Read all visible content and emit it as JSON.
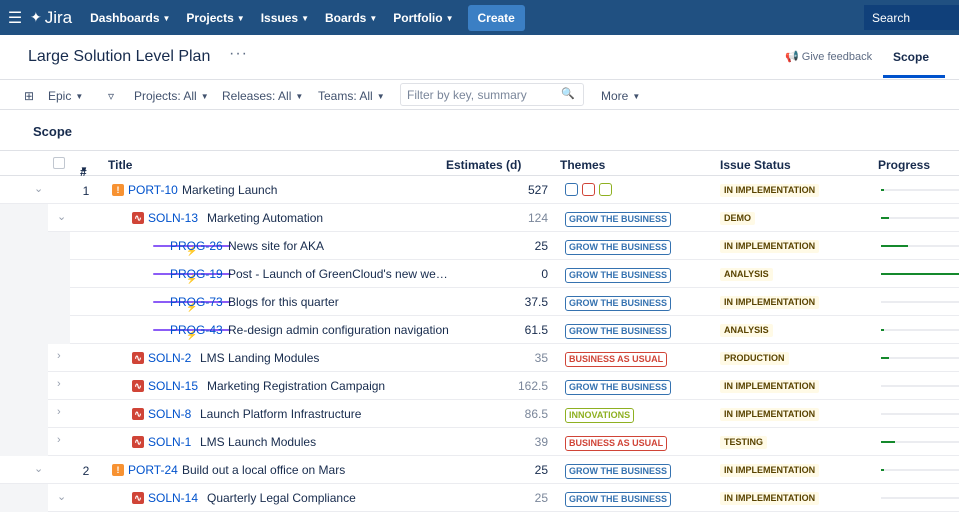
{
  "topbar": {
    "logo": "Jira",
    "nav": [
      "Dashboards",
      "Projects",
      "Issues",
      "Boards",
      "Portfolio"
    ],
    "create": "Create",
    "search": "Search"
  },
  "header": {
    "title": "Large Solution Level Plan",
    "more": "···",
    "feedback": "Give feedback",
    "scope_tab": "Scope"
  },
  "filters": {
    "hierarchy": "Epic",
    "projects": "Projects: All",
    "releases": "Releases: All",
    "teams": "Teams: All",
    "search_placeholder": "Filter by key, summary",
    "more": "More"
  },
  "section": "Scope",
  "columns": {
    "num": "#",
    "title": "Title",
    "estimates": "Estimates (d)",
    "themes": "Themes",
    "status": "Issue Status",
    "progress": "Progress"
  },
  "rows": [
    {
      "level": 0,
      "num": "1",
      "type": "port",
      "key": "PORT-10",
      "title": "Marketing Launch",
      "estimate": "527",
      "est_grey": false,
      "themes": "squares",
      "theme": "",
      "theme_style": "",
      "status": "IN IMPLEMENTATION",
      "progress": 0.03,
      "chev": "down"
    },
    {
      "level": 1,
      "num": "",
      "type": "soln",
      "key": "SOLN-13",
      "title": "Marketing Automation",
      "estimate": "124",
      "est_grey": true,
      "theme": "GROW THE BUSINESS",
      "theme_style": "grow",
      "status": "DEMO",
      "progress": 0.1,
      "chev": "down"
    },
    {
      "level": 2,
      "num": "",
      "type": "prog",
      "key": "PROG-26",
      "title": "News site for AKA",
      "estimate": "25",
      "est_grey": false,
      "theme": "GROW THE BUSINESS",
      "theme_style": "grow",
      "status": "IN IMPLEMENTATION",
      "progress": 0.35,
      "chev": ""
    },
    {
      "level": 2,
      "num": "",
      "type": "prog",
      "key": "PROG-19",
      "title": "Post - Launch of GreenCloud's new we…",
      "estimate": "0",
      "est_grey": false,
      "theme": "GROW THE BUSINESS",
      "theme_style": "grow",
      "status": "ANALYSIS",
      "progress": 1.0,
      "chev": ""
    },
    {
      "level": 2,
      "num": "",
      "type": "prog",
      "key": "PROG-73",
      "title": "Blogs for this quarter",
      "estimate": "37.5",
      "est_grey": false,
      "theme": "GROW THE BUSINESS",
      "theme_style": "grow",
      "status": "IN IMPLEMENTATION",
      "progress": 0,
      "chev": ""
    },
    {
      "level": 2,
      "num": "",
      "type": "prog",
      "key": "PROG-43",
      "title": "Re-design admin configuration navigation",
      "estimate": "61.5",
      "est_grey": false,
      "theme": "GROW THE BUSINESS",
      "theme_style": "grow",
      "status": "ANALYSIS",
      "progress": 0.02,
      "chev": ""
    },
    {
      "level": 1,
      "num": "",
      "type": "soln",
      "key": "SOLN-2",
      "title": "LMS Landing Modules",
      "estimate": "35",
      "est_grey": true,
      "theme": "BUSINESS AS USUAL",
      "theme_style": "bau",
      "status": "PRODUCTION",
      "progress": 0.1,
      "chev": "right"
    },
    {
      "level": 1,
      "num": "",
      "type": "soln",
      "key": "SOLN-15",
      "title": "Marketing Registration Campaign",
      "estimate": "162.5",
      "est_grey": true,
      "theme": "GROW THE BUSINESS",
      "theme_style": "grow",
      "status": "IN IMPLEMENTATION",
      "progress": 0,
      "chev": "right"
    },
    {
      "level": 1,
      "num": "",
      "type": "soln",
      "key": "SOLN-8",
      "title": "Launch Platform Infrastructure",
      "estimate": "86.5",
      "est_grey": true,
      "theme": "INNOVATIONS",
      "theme_style": "innov",
      "status": "IN IMPLEMENTATION",
      "progress": 0,
      "chev": "right"
    },
    {
      "level": 1,
      "num": "",
      "type": "soln",
      "key": "SOLN-1",
      "title": "LMS Launch Modules",
      "estimate": "39",
      "est_grey": true,
      "theme": "BUSINESS AS USUAL",
      "theme_style": "bau",
      "status": "TESTING",
      "progress": 0.18,
      "chev": "right"
    },
    {
      "level": 0,
      "num": "2",
      "type": "port",
      "key": "PORT-24",
      "title": "Build out a local office on Mars",
      "estimate": "25",
      "est_grey": false,
      "theme": "GROW THE BUSINESS",
      "theme_style": "grow",
      "status": "IN IMPLEMENTATION",
      "progress": 0.02,
      "chev": "down"
    },
    {
      "level": 1,
      "num": "",
      "type": "soln",
      "key": "SOLN-14",
      "title": "Quarterly Legal Compliance",
      "estimate": "25",
      "est_grey": true,
      "theme": "GROW THE BUSINESS",
      "theme_style": "grow",
      "status": "IN IMPLEMENTATION",
      "progress": 0,
      "chev": "down"
    }
  ],
  "colors": {
    "topbar": "#205081",
    "link": "#0052cc",
    "progress": "#14892c",
    "status_bg": "#fffae6"
  }
}
